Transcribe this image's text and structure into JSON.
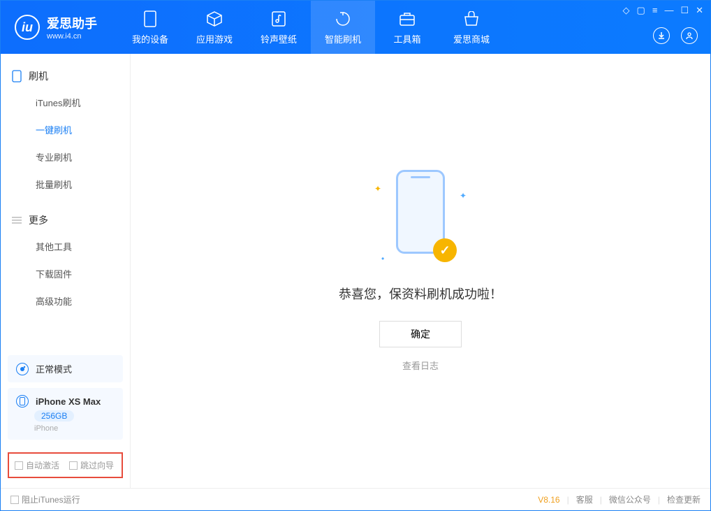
{
  "app": {
    "title": "爱思助手",
    "url": "www.i4.cn"
  },
  "nav": {
    "tab0": "我的设备",
    "tab1": "应用游戏",
    "tab2": "铃声壁纸",
    "tab3": "智能刷机",
    "tab4": "工具箱",
    "tab5": "爱思商城"
  },
  "sidebar": {
    "section1_title": "刷机",
    "items1": {
      "i0": "iTunes刷机",
      "i1": "一键刷机",
      "i2": "专业刷机",
      "i3": "批量刷机"
    },
    "section2_title": "更多",
    "items2": {
      "i0": "其他工具",
      "i1": "下载固件",
      "i2": "高级功能"
    }
  },
  "device": {
    "mode_label": "正常模式",
    "name": "iPhone XS Max",
    "capacity": "256GB",
    "type": "iPhone"
  },
  "options": {
    "auto_activate": "自动激活",
    "skip_guide": "跳过向导"
  },
  "result": {
    "title": "恭喜您，保资料刷机成功啦！",
    "ok_button": "确定",
    "log_link": "查看日志"
  },
  "footer": {
    "block_itunes": "阻止iTunes运行",
    "version": "V8.16",
    "support": "客服",
    "wechat": "微信公众号",
    "check_update": "检查更新"
  }
}
